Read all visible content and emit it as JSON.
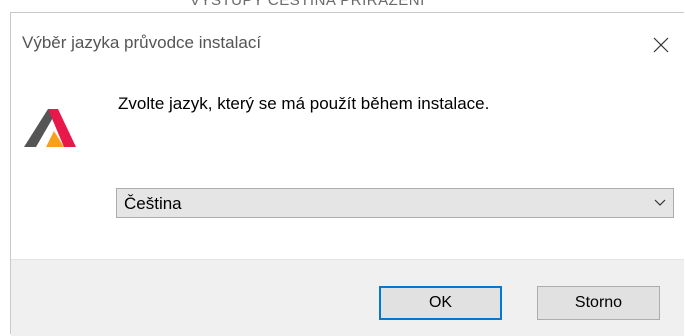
{
  "background_window": {
    "partial_text": "VYSTUPY ČEŠTINA   PŘIŘAZENÍ"
  },
  "dialog": {
    "title": "Výběr jazyka průvodce instalací",
    "prompt": "Zvolte jazyk, který se má použít během instalace.",
    "language_select": {
      "value": "Čeština"
    },
    "buttons": {
      "ok_label": "OK",
      "cancel_label": "Storno"
    }
  },
  "icons": {
    "close": "close-icon",
    "logo": "app-logo-icon",
    "dropdown": "chevron-down-icon"
  },
  "colors": {
    "focus_border": "#0078d7",
    "footer_bg": "#f0f0f0",
    "logo_dark": "#555555",
    "logo_red": "#e8194a",
    "logo_orange": "#f7a11a"
  }
}
